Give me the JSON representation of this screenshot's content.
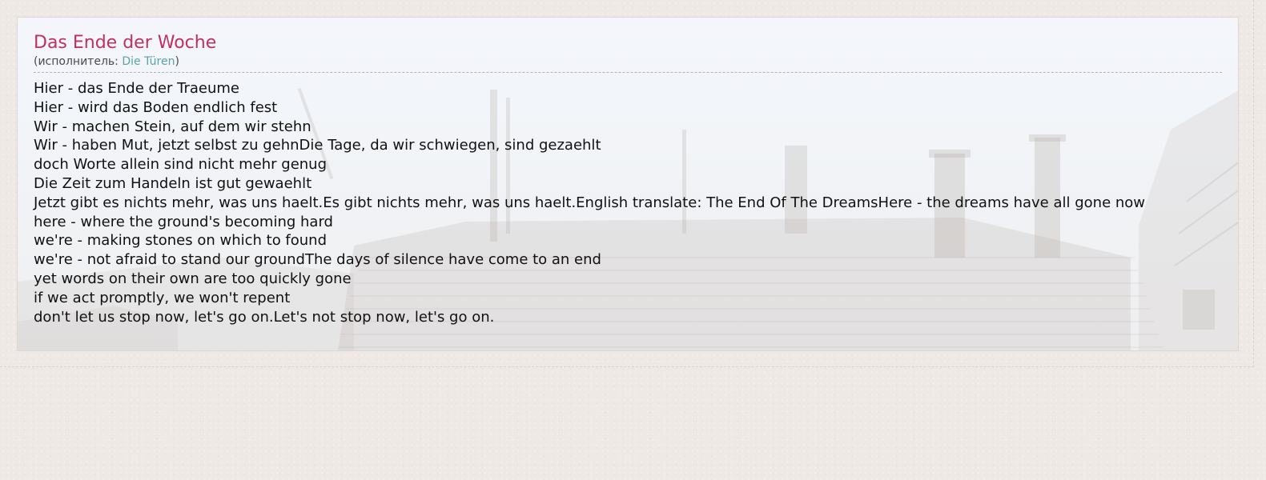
{
  "song": {
    "title": "Das Ende der Woche",
    "performer_prefix": "(исполнитель: ",
    "performer_name": "Die Türen",
    "performer_suffix": ")"
  },
  "lyrics": [
    "Hier - das Ende der Traeume",
    "Hier - wird das Boden endlich fest",
    "Wir - machen Stein, auf dem wir stehn",
    "Wir - haben Mut, jetzt selbst zu gehnDie Tage, da wir schwiegen, sind gezaehlt",
    "doch Worte allein sind nicht mehr genug",
    "Die Zeit zum Handeln ist gut gewaehlt",
    "Jetzt gibt es nichts mehr, was uns haelt.Es gibt nichts mehr, was uns haelt.English translate: The End Of The DreamsHere - the dreams have all gone now",
    "here - where the ground's becoming hard",
    "we're - making stones on which to found",
    "we're - not afraid to stand our groundThe days of silence have come to an end",
    "yet words on their own are too quickly gone",
    "if we act promptly, we won't repent",
    "don't let us stop now, let's go on.Let's not stop now, let's go on."
  ],
  "colors": {
    "title": "#c2305f",
    "link": "#5aa3a8",
    "text": "#111111",
    "page_background": "#efe9e6"
  }
}
